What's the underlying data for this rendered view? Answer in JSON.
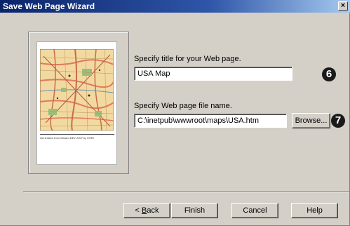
{
  "window": {
    "title": "Save Web Page Wizard",
    "close_glyph": "×"
  },
  "preview": {
    "caption": "Generated from Wizard DEV 2007 by ESRI",
    "map_icon": "map-thumbnail"
  },
  "title_section": {
    "label": "Specify title for your Web page.",
    "value": "USA Map",
    "badge": "6"
  },
  "file_section": {
    "label": "Specify Web page file name.",
    "value": "C:\\inetpub\\wwwroot\\maps\\USA.htm",
    "browse_label": "Browse...",
    "badge": "7"
  },
  "buttons": {
    "back_prefix": "< ",
    "back_mnemonic": "B",
    "back_rest": "ack",
    "finish": "Finish",
    "cancel": "Cancel",
    "help": "Help"
  },
  "colors": {
    "titlebar_start": "#0a246a",
    "titlebar_end": "#a6caf0",
    "dialog_bg": "#d4d0c8",
    "badge": "#1a1a1a"
  }
}
